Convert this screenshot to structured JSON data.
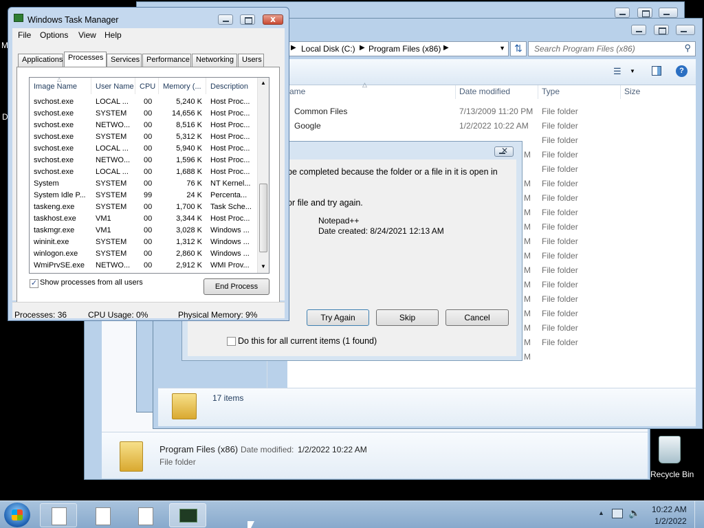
{
  "desktop": {
    "left_labels": [
      "M",
      "D"
    ],
    "recycle_bin_label": "Recycle Bin"
  },
  "explorer": {
    "breadcrumb": [
      "Local Disk (C:)",
      "Program Files (x86)"
    ],
    "search_placeholder": "Search Program Files (x86)",
    "columns": {
      "name": "ame",
      "date": "Date modified",
      "type": "Type",
      "size": "Size"
    },
    "rows": [
      {
        "name": "Common Files",
        "date": "7/13/2009 11:20 PM",
        "type": "File folder"
      },
      {
        "name": "Google",
        "date": "1/2/2022 10:22 AM",
        "type": "File folder"
      },
      {
        "name": "",
        "date": "",
        "type": "File folder"
      },
      {
        "name": "",
        "date": "",
        "type": "File folder"
      },
      {
        "name": "",
        "date": "",
        "type": "File folder"
      },
      {
        "name": "",
        "date": "",
        "type": "File folder"
      },
      {
        "name": "",
        "date": "",
        "type": "File folder"
      },
      {
        "name": "",
        "date": "",
        "type": "File folder"
      },
      {
        "name": "",
        "date": "",
        "type": "File folder"
      },
      {
        "name": "",
        "date": "",
        "type": "File folder"
      },
      {
        "name": "",
        "date": "",
        "type": "File folder"
      },
      {
        "name": "",
        "date": "",
        "type": "File folder"
      },
      {
        "name": "",
        "date": "",
        "type": "File folder"
      },
      {
        "name": "",
        "date": "",
        "type": "File folder"
      },
      {
        "name": "",
        "date": "",
        "type": "File folder"
      },
      {
        "name": "",
        "date": "",
        "type": "File folder"
      },
      {
        "name": "",
        "date": "",
        "type": "File folder"
      }
    ],
    "partial_date_marks": [
      "M",
      "M",
      "M",
      "M",
      "M",
      "M",
      "M",
      "M",
      "M",
      "M",
      "M",
      "M",
      "M",
      "M"
    ],
    "item_count": "17 items",
    "details_title": "Program Files (x86)",
    "details_date_label": "Date modified:",
    "details_date_value": "1/2/2022 10:22 AM",
    "details_type": "File folder"
  },
  "dialog": {
    "message_line1": "be completed because the folder or a file in it is open in",
    "message_line2": "or file and try again.",
    "file_name": "Notepad++",
    "file_date": "Date created: 8/24/2021 12:13 AM",
    "try_again_label": "Try Again",
    "skip_label": "Skip",
    "cancel_label": "Cancel",
    "checkbox_label": "Do this for all current items (1 found)"
  },
  "task_manager": {
    "title": "Windows Task Manager",
    "menu": [
      "File",
      "Options",
      "View",
      "Help"
    ],
    "tabs": [
      "Applications",
      "Processes",
      "Services",
      "Performance",
      "Networking",
      "Users"
    ],
    "active_tab": "Processes",
    "columns": [
      "Image Name",
      "User Name",
      "CPU",
      "Memory (...",
      "Description"
    ],
    "processes": [
      [
        "svchost.exe",
        "LOCAL ...",
        "00",
        "5,240 K",
        "Host Proc..."
      ],
      [
        "svchost.exe",
        "SYSTEM",
        "00",
        "14,656 K",
        "Host Proc..."
      ],
      [
        "svchost.exe",
        "NETWO...",
        "00",
        "8,516 K",
        "Host Proc..."
      ],
      [
        "svchost.exe",
        "SYSTEM",
        "00",
        "5,312 K",
        "Host Proc..."
      ],
      [
        "svchost.exe",
        "LOCAL ...",
        "00",
        "5,940 K",
        "Host Proc..."
      ],
      [
        "svchost.exe",
        "NETWO...",
        "00",
        "1,596 K",
        "Host Proc..."
      ],
      [
        "svchost.exe",
        "LOCAL ...",
        "00",
        "1,688 K",
        "Host Proc..."
      ],
      [
        "System",
        "SYSTEM",
        "00",
        "76 K",
        "NT Kernel..."
      ],
      [
        "System Idle P...",
        "SYSTEM",
        "99",
        "24 K",
        "Percenta..."
      ],
      [
        "taskeng.exe",
        "SYSTEM",
        "00",
        "1,700 K",
        "Task Sche..."
      ],
      [
        "taskhost.exe",
        "VM1",
        "00",
        "3,344 K",
        "Host Proc..."
      ],
      [
        "taskmgr.exe",
        "VM1",
        "00",
        "3,028 K",
        "Windows ..."
      ],
      [
        "wininit.exe",
        "SYSTEM",
        "00",
        "1,312 K",
        "Windows ..."
      ],
      [
        "winlogon.exe",
        "SYSTEM",
        "00",
        "2,860 K",
        "Windows ..."
      ],
      [
        "WmiPrvSE.exe",
        "NETWO...",
        "00",
        "2,912 K",
        "WMI Prov..."
      ]
    ],
    "show_all_label": "Show processes from all users",
    "show_all_checked": true,
    "end_process_label": "End Process",
    "status_processes": "Processes: 36",
    "status_cpu": "CPU Usage: 0%",
    "status_memory": "Physical Memory: 9%"
  },
  "taskbar": {
    "time": "10:22 AM",
    "date": "1/2/2022"
  },
  "colors": {
    "desktop": "#000000",
    "window_frame": "#b9d1ea",
    "taskbar": "#98b6d5",
    "link_text": "#1e395b"
  }
}
